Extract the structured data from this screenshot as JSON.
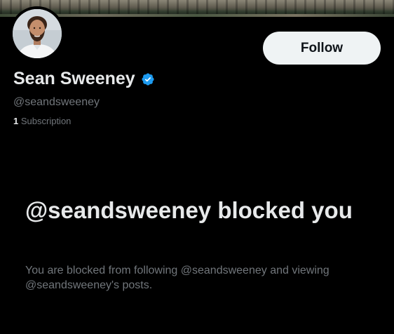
{
  "profile": {
    "display_name": "Sean Sweeney",
    "handle": "@seandsweeney",
    "verified_icon": "verified-badge-icon",
    "subscriptions_count": "1",
    "subscriptions_label": "Subscription"
  },
  "actions": {
    "follow_label": "Follow"
  },
  "blocked": {
    "title": "@seandsweeney blocked you",
    "description": "You are blocked from following @seandsweeney and viewing @seandsweeney's posts."
  },
  "colors": {
    "background": "#000000",
    "primary_text": "#e7e9ea",
    "secondary_text": "#71767b",
    "verified_blue": "#1d9bf0",
    "follow_button_bg": "#eff3f4"
  }
}
